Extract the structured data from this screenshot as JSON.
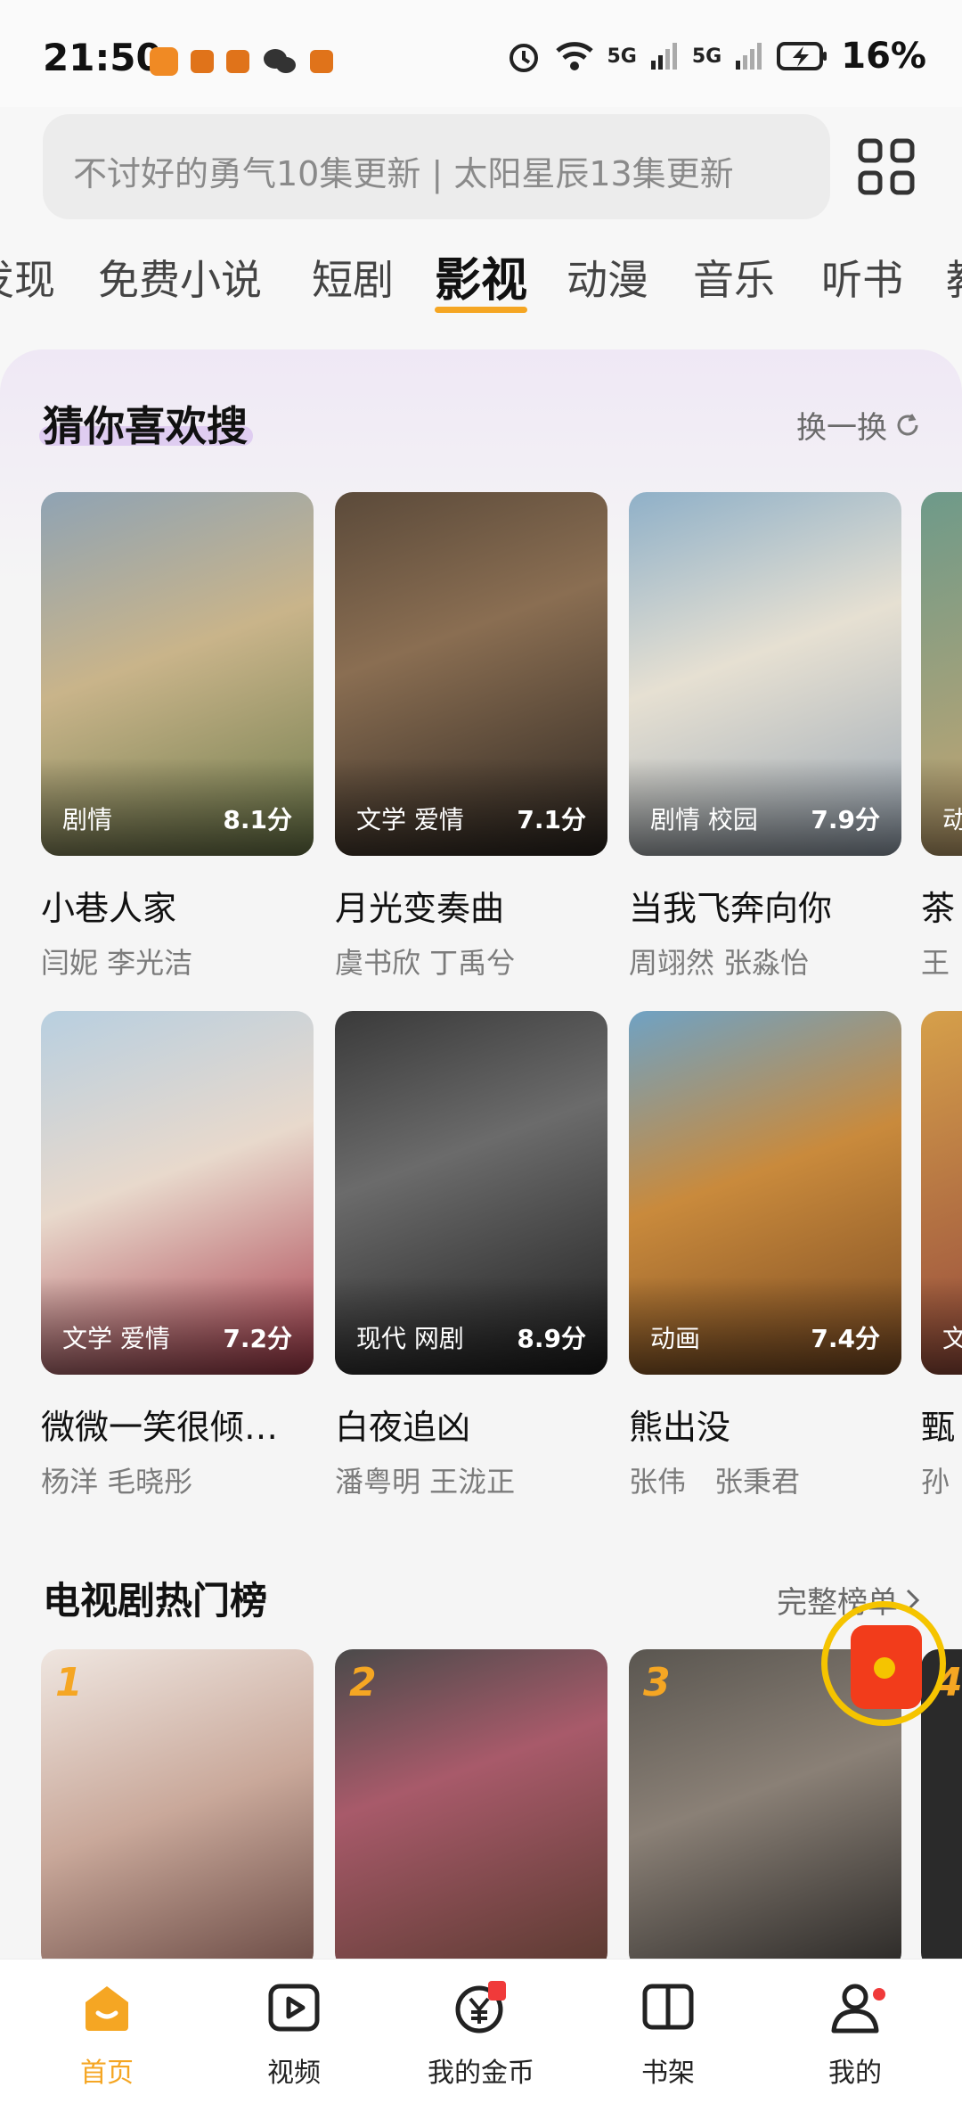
{
  "status_bar": {
    "time": "21:50",
    "net1": "5G",
    "net2": "5G",
    "battery_pct": "16%"
  },
  "search": {
    "placeholder": "不讨好的勇气10集更新 | 太阳星辰13集更新"
  },
  "channel_tabs": [
    {
      "label": "发现"
    },
    {
      "label": "免费小说"
    },
    {
      "label": "短剧"
    },
    {
      "label": "影视",
      "active": true
    },
    {
      "label": "动漫"
    },
    {
      "label": "音乐"
    },
    {
      "label": "听书"
    },
    {
      "label": "教"
    }
  ],
  "guess_section": {
    "title": "猜你喜欢搜",
    "refresh": "换一换"
  },
  "guess_row1": [
    {
      "title": "小巷人家",
      "cast": "闫妮 李光洁",
      "tags": "剧情",
      "score": "8.1分"
    },
    {
      "title": "月光变奏曲",
      "cast": "虞书欣 丁禹兮",
      "tags": "文学 爱情",
      "score": "7.1分"
    },
    {
      "title": "当我飞奔向你",
      "cast": "周翊然 张淼怡",
      "tags": "剧情 校园",
      "score": "7.9分"
    },
    {
      "title": "茶",
      "cast": "王",
      "tags": "动",
      "score": ""
    }
  ],
  "guess_row2": [
    {
      "title": "微微一笑很倾…",
      "cast": "杨洋 毛晓彤",
      "tags": "文学 爱情",
      "score": "7.2分"
    },
    {
      "title": "白夜追凶",
      "cast": "潘粤明 王泷正",
      "tags": "现代 网剧",
      "score": "8.9分"
    },
    {
      "title": "熊出没",
      "cast": "张伟　张秉君",
      "tags": "动画",
      "score": "7.4分"
    },
    {
      "title": "甄",
      "cast": "孙",
      "tags": "文",
      "score": ""
    }
  ],
  "ranking_section": {
    "title": "电视剧热门榜",
    "more": "完整榜单"
  },
  "ranking": [
    {
      "rank": "1"
    },
    {
      "rank": "2"
    },
    {
      "rank": "3"
    },
    {
      "rank": "4"
    }
  ],
  "bottom_nav": [
    {
      "label": "首页",
      "icon": "home-icon",
      "active": true
    },
    {
      "label": "视频",
      "icon": "video-icon"
    },
    {
      "label": "我的金币",
      "icon": "coin-icon"
    },
    {
      "label": "书架",
      "icon": "bookshelf-icon"
    },
    {
      "label": "我的",
      "icon": "profile-icon"
    }
  ],
  "colors": {
    "accent": "#f5a623",
    "badge_red": "#f03a3a"
  }
}
